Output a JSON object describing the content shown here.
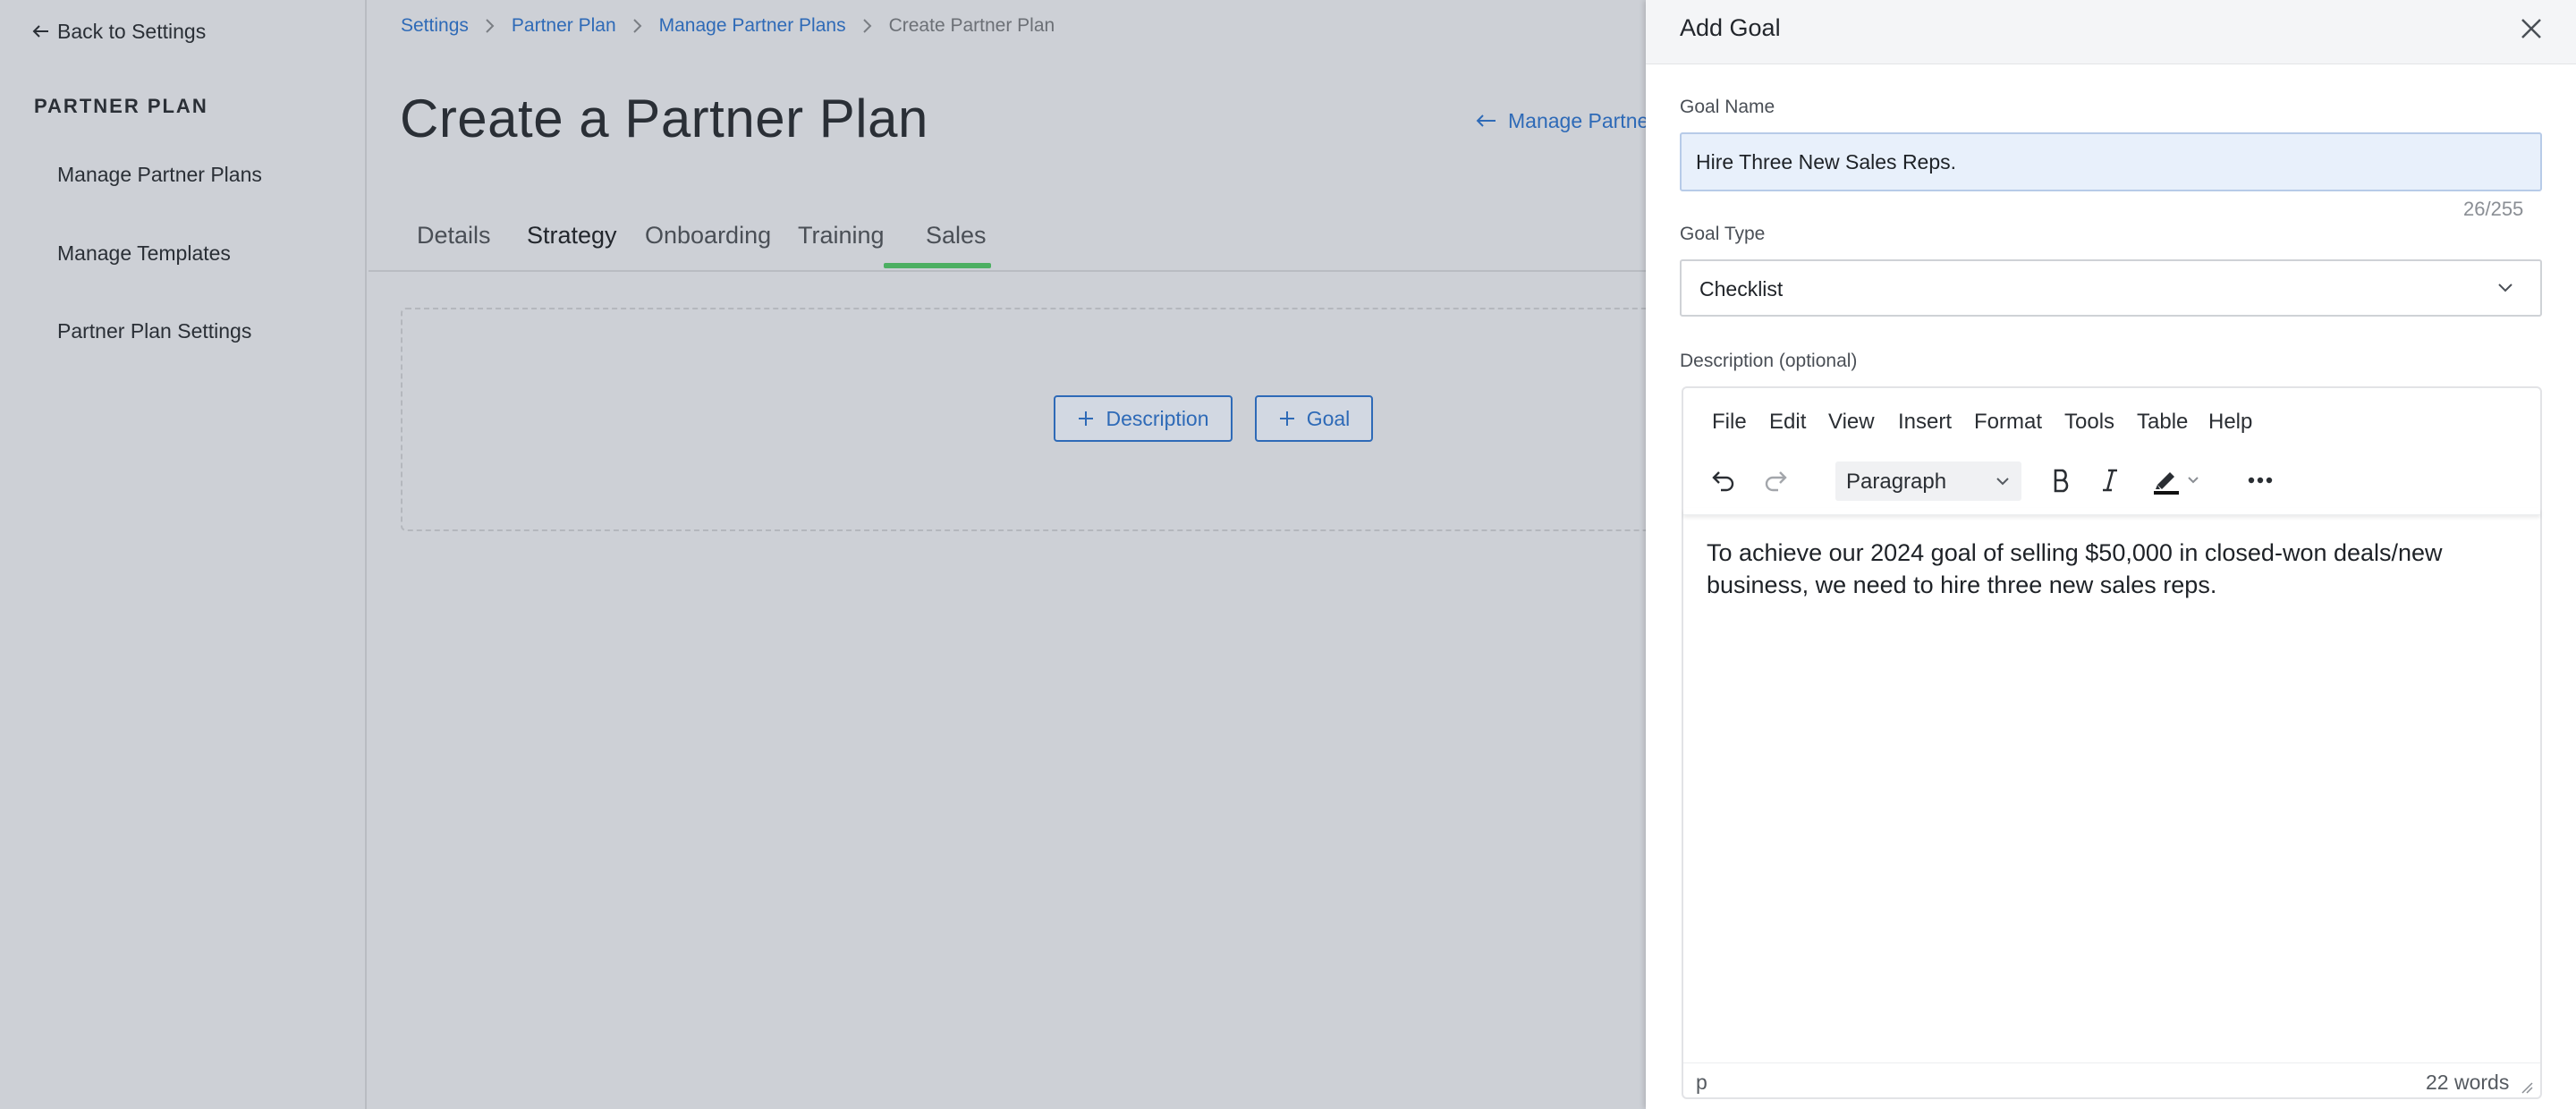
{
  "sidebar": {
    "back_label": "Back to Settings",
    "heading": "PARTNER PLAN",
    "items": [
      {
        "label": "Manage Partner Plans"
      },
      {
        "label": "Manage Templates"
      },
      {
        "label": "Partner Plan Settings"
      }
    ]
  },
  "breadcrumb": {
    "items": [
      {
        "label": "Settings"
      },
      {
        "label": "Partner Plan"
      },
      {
        "label": "Manage Partner Plans"
      },
      {
        "label": "Create Partner Plan"
      }
    ]
  },
  "main": {
    "title": "Create a Partner Plan",
    "manage_link_label": "Manage Partner",
    "tabs": [
      {
        "label": "Details"
      },
      {
        "label": "Strategy",
        "active": true
      },
      {
        "label": "Onboarding"
      },
      {
        "label": "Training"
      },
      {
        "label": "Sales"
      }
    ],
    "add_description_label": "Description",
    "add_goal_label": "Goal"
  },
  "drawer": {
    "title": "Add Goal",
    "goal_name": {
      "label": "Goal Name",
      "value": "Hire Three New Sales Reps.",
      "char_count": "26/255"
    },
    "goal_type": {
      "label": "Goal Type",
      "value": "Checklist"
    },
    "description": {
      "label": "Description (optional)",
      "menubar": [
        "File",
        "Edit",
        "View",
        "Insert",
        "Format",
        "Tools",
        "Table",
        "Help"
      ],
      "block_format": "Paragraph",
      "content": "To achieve our 2024 goal of selling $50,000 in closed-won deals/new business, we need to hire three new sales reps.",
      "status_path": "p",
      "word_count": "22 words"
    }
  },
  "colors": {
    "link": "#2e6ab7",
    "active_tab_underline": "#4caf62",
    "background": "#cdd0d6",
    "input_highlight": "#e8f0fb"
  }
}
